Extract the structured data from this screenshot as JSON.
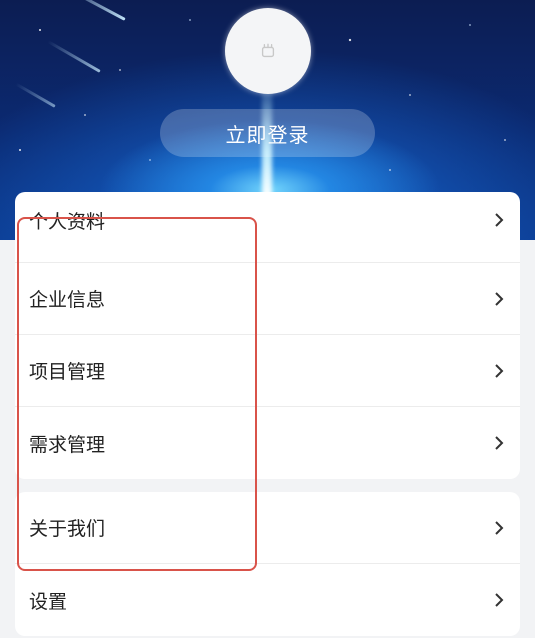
{
  "header": {
    "login_label": "立即登录",
    "avatar_icon": "avatar-placeholder-icon"
  },
  "menu_group_1": [
    {
      "label": "个人资料",
      "icon": "chevron-right-icon"
    },
    {
      "label": "企业信息",
      "icon": "chevron-right-icon"
    },
    {
      "label": "项目管理",
      "icon": "chevron-right-icon"
    },
    {
      "label": "需求管理",
      "icon": "chevron-right-icon"
    }
  ],
  "menu_group_2": [
    {
      "label": "关于我们",
      "icon": "chevron-right-icon"
    },
    {
      "label": "设置",
      "icon": "chevron-right-icon"
    }
  ],
  "colors": {
    "highlight_border": "#d9534a",
    "header_dark": "#0c1d52",
    "header_glow": "#78dcff"
  }
}
